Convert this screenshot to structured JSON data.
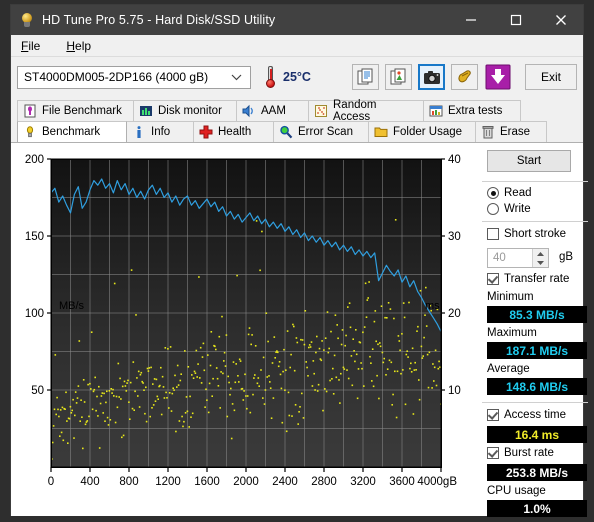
{
  "window": {
    "title": "HD Tune Pro 5.75 - Hard Disk/SSD Utility",
    "icon": "lightbulb-icon",
    "minimize": "minimize-icon",
    "maximize": "maximize-icon",
    "close": "close-icon"
  },
  "menu": {
    "items": [
      {
        "label": "File",
        "mnemonic": "F"
      },
      {
        "label": "Help",
        "mnemonic": "H"
      }
    ]
  },
  "toolbar": {
    "drive": "ST4000DM005-2DP166 (4000 gB)",
    "drive_chevron": "chevron-down-icon",
    "temperature": "25°C",
    "thermometer": "thermometer-icon",
    "buttons": [
      {
        "name": "copy-text-button",
        "icon": "copy-document-icon",
        "selected": false
      },
      {
        "name": "copy-image-button",
        "icon": "copy-image-icon",
        "selected": false
      },
      {
        "name": "screenshot-button",
        "icon": "camera-icon",
        "selected": true
      },
      {
        "name": "plug-button",
        "icon": "plug-icon",
        "selected": false
      },
      {
        "name": "download-button",
        "icon": "download-arrow-icon",
        "selected": false
      }
    ],
    "exit_label": "Exit"
  },
  "tabs": {
    "row1": [
      {
        "label": "File Benchmark",
        "icon": "file-benchmark-icon",
        "active": false
      },
      {
        "label": "Disk monitor",
        "icon": "bar-chart-icon",
        "active": false
      },
      {
        "label": "AAM",
        "icon": "speaker-icon",
        "active": false
      },
      {
        "label": "Random Access",
        "icon": "scatter-icon",
        "active": false
      },
      {
        "label": "Extra tests",
        "icon": "extra-tests-icon",
        "active": false
      }
    ],
    "row2": [
      {
        "label": "Benchmark",
        "icon": "lightbulb-icon",
        "active": true
      },
      {
        "label": "Info",
        "icon": "info-icon",
        "active": false
      },
      {
        "label": "Health",
        "icon": "red-cross-icon",
        "active": false
      },
      {
        "label": "Error Scan",
        "icon": "magnifier-icon",
        "active": false
      },
      {
        "label": "Folder Usage",
        "icon": "folder-icon",
        "active": false
      },
      {
        "label": "Erase",
        "icon": "trash-icon",
        "active": false
      }
    ]
  },
  "sidebar": {
    "start_label": "Start",
    "mode": {
      "read_label": "Read",
      "write_label": "Write",
      "selected": "Read"
    },
    "short_stroke": {
      "label": "Short stroke",
      "checked": false,
      "value": "40",
      "unit": "gB"
    },
    "transfer_rate": {
      "label": "Transfer rate",
      "checked": true
    },
    "stats": [
      {
        "label": "Minimum",
        "value": "85.3 MB/s",
        "color": "cyan"
      },
      {
        "label": "Maximum",
        "value": "187.1 MB/s",
        "color": "cyan"
      },
      {
        "label": "Average",
        "value": "148.6 MB/s",
        "color": "cyan"
      }
    ],
    "access_time": {
      "label": "Access time",
      "checked": true,
      "value": "16.4 ms",
      "color": "yellow"
    },
    "burst_rate": {
      "label": "Burst rate",
      "checked": true,
      "value": "253.8 MB/s",
      "color": "white"
    },
    "cpu_usage": {
      "label": "CPU usage",
      "value": "1.0%",
      "color": "white"
    }
  },
  "chart_data": {
    "type": "line",
    "title": "",
    "xlabel": "gB",
    "ylabel": "MB/s",
    "y2label": "ms",
    "xlim": [
      0,
      4000
    ],
    "ylim": [
      0,
      200
    ],
    "y2lim": [
      0,
      40
    ],
    "grid": true,
    "xticks": [
      0,
      400,
      800,
      1200,
      1600,
      2000,
      2400,
      2800,
      3200,
      3600,
      4000
    ],
    "yticks": [
      50,
      100,
      150,
      200
    ],
    "y2ticks": [
      10,
      20,
      30,
      40
    ],
    "background": "#2b2b2b",
    "series": [
      {
        "name": "Transfer rate",
        "type": "line",
        "color": "#2f9fe0",
        "axis": "left",
        "x": [
          0,
          40,
          80,
          120,
          160,
          200,
          240,
          280,
          320,
          360,
          400,
          440,
          480,
          520,
          560,
          600,
          640,
          680,
          720,
          760,
          800,
          840,
          880,
          920,
          960,
          1000,
          1040,
          1080,
          1120,
          1160,
          1200,
          1240,
          1280,
          1320,
          1360,
          1400,
          1440,
          1480,
          1520,
          1560,
          1600,
          1640,
          1680,
          1720,
          1760,
          1800,
          1840,
          1880,
          1920,
          1960,
          2000,
          2040,
          2080,
          2120,
          2160,
          2200,
          2240,
          2280,
          2320,
          2360,
          2400,
          2440,
          2480,
          2520,
          2560,
          2600,
          2640,
          2680,
          2720,
          2760,
          2800,
          2840,
          2880,
          2920,
          2960,
          3000,
          3040,
          3080,
          3120,
          3160,
          3200,
          3240,
          3280,
          3320,
          3360,
          3400,
          3440,
          3480,
          3520,
          3560,
          3600,
          3640,
          3680,
          3720,
          3760,
          3800,
          3840,
          3880,
          3920,
          3960,
          4000
        ],
        "y": [
          178,
          181,
          172,
          176,
          170,
          165,
          177,
          182,
          168,
          172,
          180,
          186,
          183,
          187,
          181,
          184,
          178,
          186,
          180,
          184,
          177,
          181,
          175,
          179,
          174,
          180,
          183,
          177,
          181,
          175,
          178,
          172,
          176,
          170,
          174,
          176,
          170,
          173,
          168,
          171,
          174,
          169,
          172,
          166,
          169,
          163,
          166,
          161,
          164,
          159,
          162,
          165,
          160,
          163,
          158,
          161,
          156,
          159,
          155,
          158,
          153,
          156,
          151,
          154,
          149,
          152,
          147,
          150,
          146,
          149,
          144,
          147,
          143,
          146,
          141,
          144,
          140,
          143,
          138,
          141,
          137,
          140,
          136,
          139,
          121,
          126,
          131,
          127,
          124,
          128,
          120,
          124,
          117,
          121,
          114,
          110,
          105,
          101,
          97,
          93,
          88
        ]
      },
      {
        "name": "Access time",
        "type": "scatter",
        "color": "#e8e81a",
        "axis": "right",
        "points_approx": 440,
        "note": "Yellow scatter of per-seek access times, mostly 2-22 ms, denser and lower toward the start of the drive"
      }
    ]
  }
}
